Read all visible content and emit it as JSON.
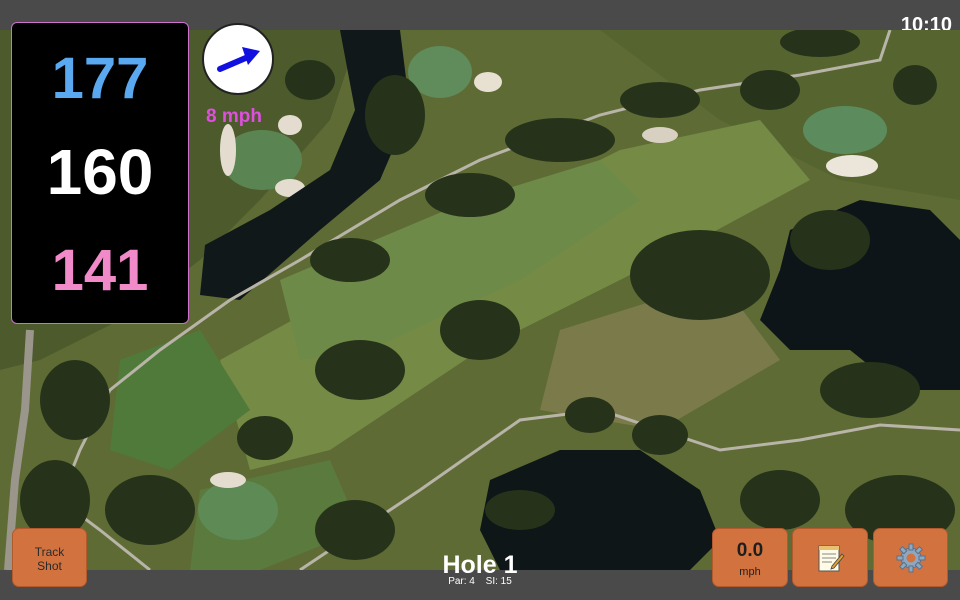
{
  "status": {
    "clock": "10:10"
  },
  "distances": {
    "back": "177",
    "middle": "160",
    "front": "141",
    "colors": {
      "back": "#5aa8f0",
      "middle": "#ffffff",
      "front": "#f08ac8"
    }
  },
  "wind": {
    "speed": "8 mph",
    "icon": "wind-arrow-icon",
    "arrow_color": "#1010e0",
    "speed_color": "#e04ee0"
  },
  "hole": {
    "title": "Hole 1",
    "par": "Par: 4",
    "stroke_index": "SI: 15"
  },
  "buttons": {
    "track_shot": {
      "line1": "Track",
      "line2": "Shot"
    },
    "speed": {
      "value": "0.0",
      "unit": "mph"
    },
    "notes": {
      "icon": "notepad-icon"
    },
    "settings": {
      "icon": "gear-icon"
    }
  },
  "accent_color": "#d2733f"
}
